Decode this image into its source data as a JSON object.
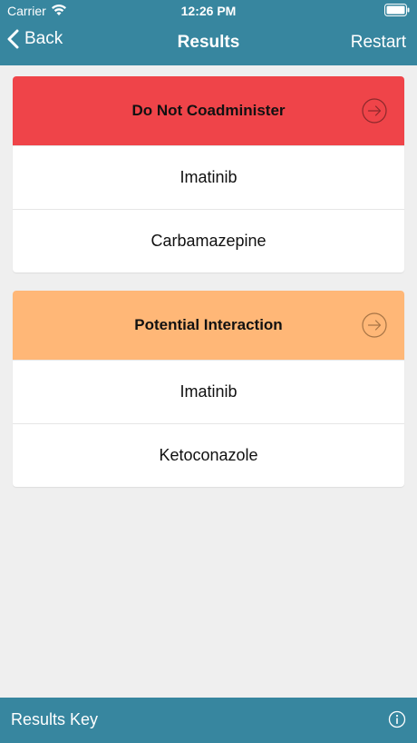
{
  "status_bar": {
    "carrier": "Carrier",
    "time": "12:26 PM"
  },
  "nav": {
    "back_label": "Back",
    "title": "Results",
    "restart_label": "Restart"
  },
  "groups": [
    {
      "header": "Do Not Coadminister",
      "color": "#ef4449",
      "drugs": [
        "Imatinib",
        "Carbamazepine"
      ]
    },
    {
      "header": "Potential Interaction",
      "color": "#ffb777",
      "drugs": [
        "Imatinib",
        "Ketoconazole"
      ]
    }
  ],
  "footer": {
    "results_key_label": "Results Key"
  },
  "colors": {
    "bar": "#37869f",
    "background": "#efefef"
  }
}
